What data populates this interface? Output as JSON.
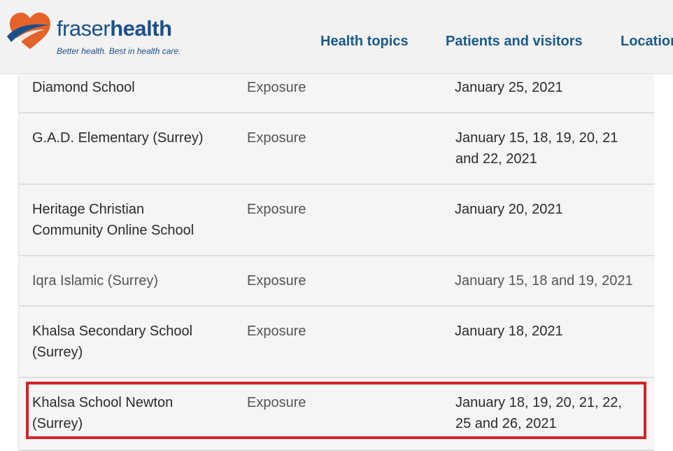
{
  "header": {
    "brand_part1": "fraser",
    "brand_part2": "health",
    "tagline": "Better health. Best in health care.",
    "nav": [
      "Health topics",
      "Patients and visitors",
      "Location"
    ]
  },
  "colors": {
    "brand_blue": "#1a4f8b",
    "logo_orange": "#e5622a",
    "highlight_red": "#d1242a"
  },
  "table": {
    "rows": [
      {
        "school": "Diamond School",
        "type": "Exposure",
        "dates": "January 25, 2021"
      },
      {
        "school": "G.A.D. Elementary (Surrey)",
        "type": "Exposure",
        "dates": "January 15, 18, 19, 20, 21 and 22, 2021"
      },
      {
        "school": "Heritage Christian Community Online School",
        "type": "Exposure",
        "dates": "January 20, 2021"
      },
      {
        "school": "Iqra Islamic (Surrey)",
        "type": "Exposure",
        "dates": "January 15, 18 and 19, 2021"
      },
      {
        "school": "Khalsa Secondary School (Surrey)",
        "type": "Exposure",
        "dates": "January 18, 2021"
      },
      {
        "school": "Khalsa School Newton (Surrey)",
        "type": "Exposure",
        "dates": "January 18, 19, 20, 21, 22, 25  and 26, 2021"
      }
    ]
  }
}
